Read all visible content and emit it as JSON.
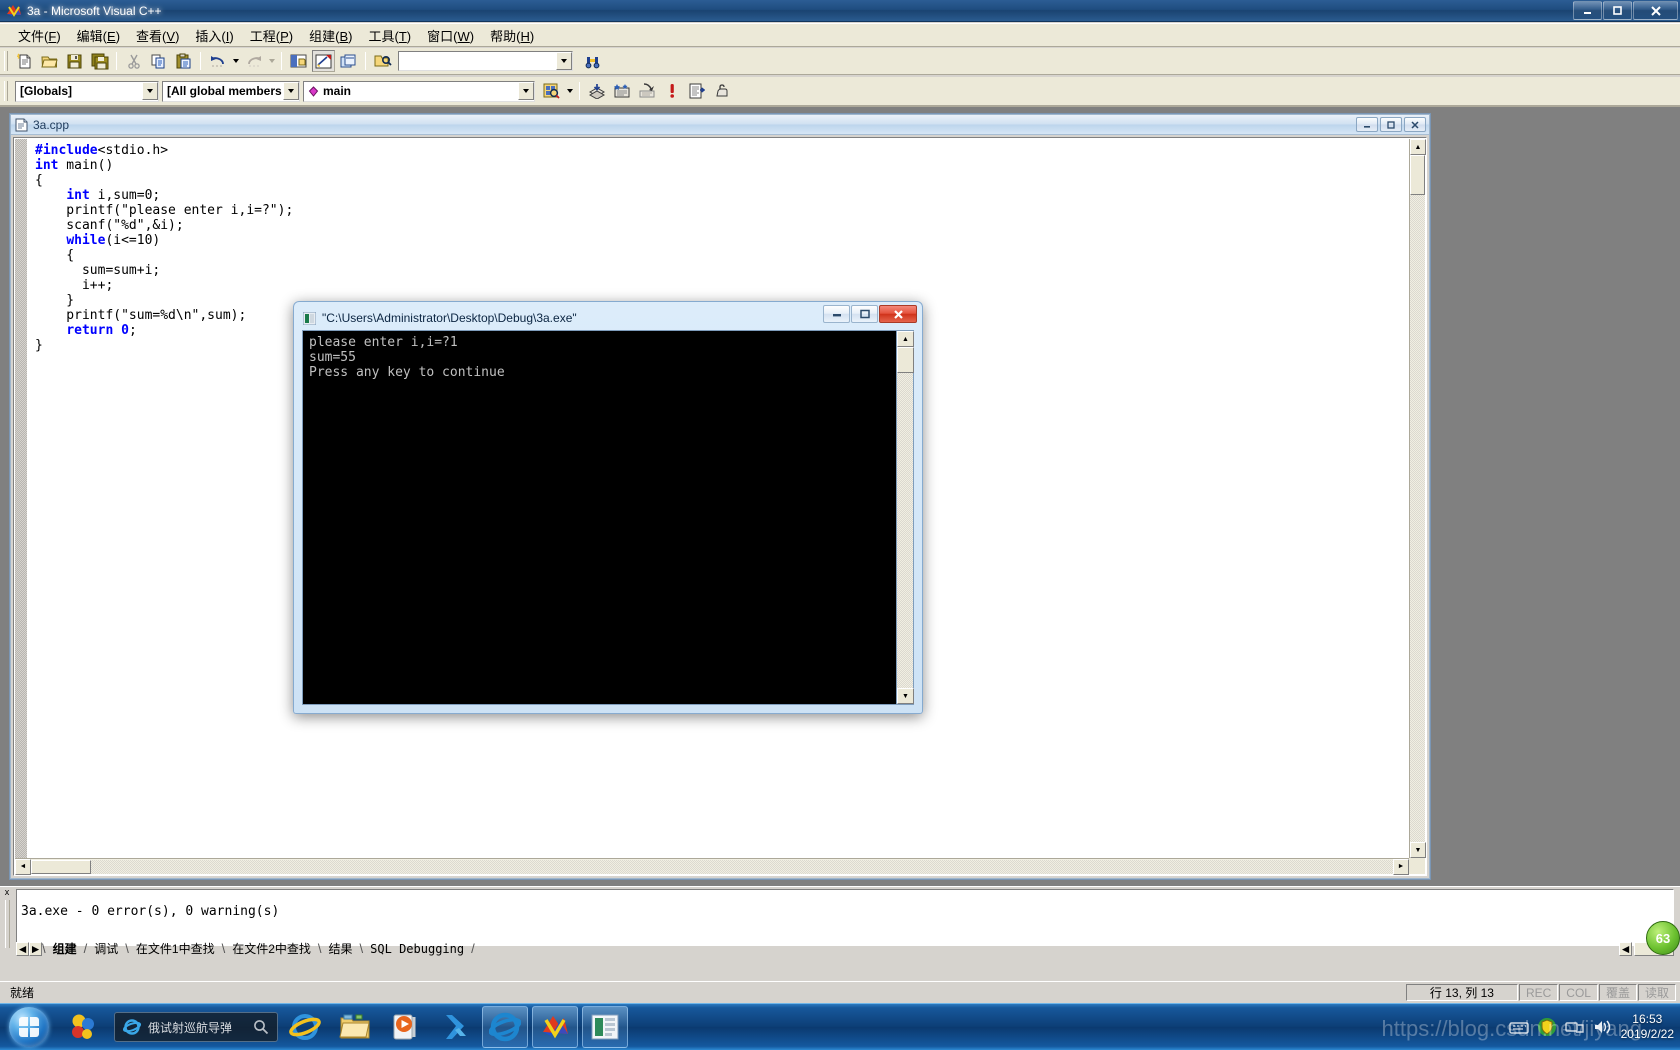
{
  "window": {
    "title": "3a - Microsoft Visual C++",
    "icon": "visual-cpp-icon",
    "buttons": {
      "minimize": "—",
      "maximize": "❐",
      "close": "✕"
    }
  },
  "menubar": [
    {
      "label": "文件",
      "accel": "F"
    },
    {
      "label": "编辑",
      "accel": "E"
    },
    {
      "label": "查看",
      "accel": "V"
    },
    {
      "label": "插入",
      "accel": "I"
    },
    {
      "label": "工程",
      "accel": "P"
    },
    {
      "label": "组建",
      "accel": "B"
    },
    {
      "label": "工具",
      "accel": "T"
    },
    {
      "label": "窗口",
      "accel": "W"
    },
    {
      "label": "帮助",
      "accel": "H"
    }
  ],
  "toolbar_standard": {
    "buttons": [
      "new-document-icon",
      "open-folder-icon",
      "save-icon",
      "save-all-icon",
      "cut-icon",
      "copy-icon",
      "paste-icon",
      "undo-icon",
      "redo-icon",
      "workspace-icon",
      "output-window-icon",
      "window-list-icon",
      "find-in-files-icon"
    ],
    "find_box_value": "",
    "find_box_placeholder": "",
    "search_help_icon": "find-binoculars-icon"
  },
  "toolbar_wizardbar": {
    "combo_scope": "[Globals]",
    "combo_members": "[All global members",
    "combo_function": "main",
    "function_icon": "function-diamond-icon",
    "buttons": [
      "compile-icon",
      "build-icon",
      "stop-build-icon",
      "execute-program-icon",
      "go-debug-icon",
      "insert-breakpoint-icon"
    ]
  },
  "editor_window": {
    "document_name": "3a.cpp",
    "document_icon": "cpp-source-icon",
    "buttons": {
      "minimize": "—",
      "restore": "❐",
      "close": "✕"
    },
    "code_lines": [
      [
        {
          "t": "#include",
          "c": "pp"
        },
        {
          "t": "<stdio.h>",
          "c": ""
        }
      ],
      [
        {
          "t": "int",
          "c": "kw"
        },
        {
          "t": " main()",
          "c": ""
        }
      ],
      [
        {
          "t": "{",
          "c": ""
        }
      ],
      [
        {
          "t": "    ",
          "c": ""
        },
        {
          "t": "int",
          "c": "kw"
        },
        {
          "t": " i,sum=0;",
          "c": ""
        }
      ],
      [
        {
          "t": "    printf(\"please enter i,i=?\");",
          "c": ""
        }
      ],
      [
        {
          "t": "    scanf(\"%d\",&i);",
          "c": ""
        }
      ],
      [
        {
          "t": "    ",
          "c": ""
        },
        {
          "t": "while",
          "c": "kw"
        },
        {
          "t": "(i<=10)",
          "c": ""
        }
      ],
      [
        {
          "t": "    {",
          "c": ""
        }
      ],
      [
        {
          "t": "      sum=sum+i;",
          "c": ""
        }
      ],
      [
        {
          "t": "      i++;",
          "c": ""
        }
      ],
      [
        {
          "t": "    }",
          "c": ""
        }
      ],
      [
        {
          "t": "    printf(\"sum=%d\\n\",sum);",
          "c": ""
        }
      ],
      [
        {
          "t": "    ",
          "c": ""
        },
        {
          "t": "return",
          "c": "kw"
        },
        {
          "t": " ",
          "c": ""
        },
        {
          "t": "0",
          "c": "kw"
        },
        {
          "t": ";",
          "c": ""
        }
      ],
      [
        {
          "t": "}",
          "c": ""
        }
      ]
    ]
  },
  "console_window": {
    "title": "\"C:\\Users\\Administrator\\Desktop\\Debug\\3a.exe\"",
    "icon": "console-window-icon",
    "buttons": {
      "minimize": "—",
      "maximize": "❐",
      "close": "✕"
    },
    "output": "please enter i,i=?1\nsum=55\nPress any key to continue"
  },
  "output_panel": {
    "text": "3a.exe - 0 error(s), 0 warning(s)",
    "close_glyph": "x",
    "tabs": [
      {
        "label": "组建",
        "active": true,
        "mono": false
      },
      {
        "label": "调试",
        "active": false,
        "mono": false
      },
      {
        "label": "在文件1中查找",
        "active": false,
        "mono": false
      },
      {
        "label": "在文件2中查找",
        "active": false,
        "mono": false
      },
      {
        "label": "结果",
        "active": false,
        "mono": false
      },
      {
        "label": "SQL Debugging",
        "active": false,
        "mono": true
      }
    ],
    "nav_left": "◄",
    "nav_right": "►"
  },
  "statusbar": {
    "ready": "就绪",
    "position": "行 13, 列 13",
    "indicators": [
      "REC",
      "COL",
      "覆盖",
      "读取"
    ]
  },
  "taskbar": {
    "start_icon": "windows-start-orb",
    "pinned_first_icon": "sogou-pinyin-icon",
    "search": {
      "icon": "ie-small-icon",
      "text": "俄试射巡航导弹",
      "magnifier": "search-icon"
    },
    "items": [
      {
        "icon": "internet-explorer-icon",
        "active": false
      },
      {
        "icon": "file-explorer-icon",
        "active": false
      },
      {
        "icon": "media-player-icon",
        "active": false
      },
      {
        "icon": "kingsoft-icon",
        "active": false
      },
      {
        "icon": "ie-browser-icon",
        "active": true
      },
      {
        "icon": "visual-cpp-icon",
        "active": true
      },
      {
        "icon": "console-window-icon",
        "active": true
      }
    ],
    "tray": [
      "keyboard-icon",
      "safety-shield-icon",
      "network-icon",
      "volume-icon"
    ],
    "clock_time": "16:53",
    "clock_date": "2019/2/22"
  },
  "watermark": "https://blog.csdn.net/jiyang",
  "chat_ball": "63",
  "colors": {
    "accent_title": "#1a4371",
    "keyword_blue": "#0000ff",
    "face": "#d6d3ce",
    "console_bg": "#000000",
    "close_red": "#cf3119"
  }
}
